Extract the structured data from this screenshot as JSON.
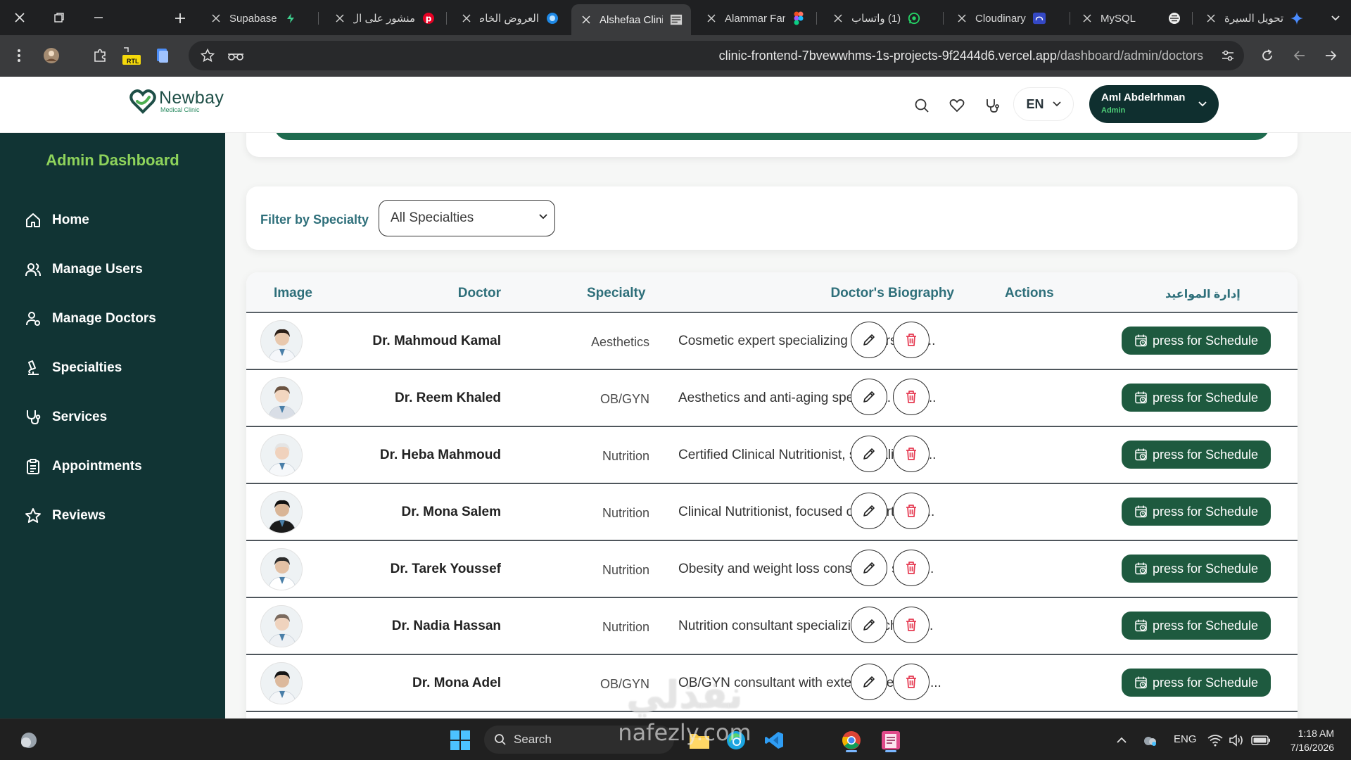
{
  "browser": {
    "tabs": [
      {
        "title": "Supabase",
        "icon": "supabase-icon"
      },
      {
        "title": "منشور على ال",
        "icon": "pinterest-icon"
      },
      {
        "title": "العروض الخاصة",
        "icon": "circle-icon"
      },
      {
        "title": "Alshefaa Clinic",
        "icon": "page-icon",
        "active": true
      },
      {
        "title": "Alammar Family",
        "icon": "figma-icon"
      },
      {
        "title": "(1) واتساب",
        "icon": "whatsapp-icon"
      },
      {
        "title": "Cloudinary",
        "icon": "cloudinary-icon"
      },
      {
        "title": "MySQL",
        "icon": "mysql-icon"
      },
      {
        "title": "تحويل السيرة",
        "icon": "gemini-icon"
      }
    ],
    "url_host": "clinic-frontend-7bvewwhms-1s-projects-9f2444d6.vercel.app",
    "url_path": "/dashboard/admin/doctors",
    "rtl_badge": "RTL"
  },
  "header": {
    "logo_name": "Newbay",
    "logo_sub": "Medical Clinic",
    "lang": "EN",
    "user_name": "Aml Abdelrhman",
    "user_role": "Admin"
  },
  "sidebar": {
    "title": "Admin Dashboard",
    "items": [
      {
        "label": "Home",
        "icon": "home-icon"
      },
      {
        "label": "Manage Users",
        "icon": "users-icon"
      },
      {
        "label": "Manage Doctors",
        "icon": "doctor-icon"
      },
      {
        "label": "Specialties",
        "icon": "specialties-icon"
      },
      {
        "label": "Services",
        "icon": "stethoscope-icon"
      },
      {
        "label": "Appointments",
        "icon": "clipboard-icon"
      },
      {
        "label": "Reviews",
        "icon": "star-icon"
      }
    ]
  },
  "filter": {
    "label": "Filter by Specialty",
    "selected": "All Specialties"
  },
  "table": {
    "headers": {
      "image": "Image",
      "doctor": "Doctor",
      "specialty": "Specialty",
      "bio": "Doctor's Biography",
      "actions": "Actions",
      "schedule": "إدارة المواعيد"
    },
    "schedule_label": "press for Schedule",
    "rows": [
      {
        "name": "Dr. Mahmoud Kamal",
        "specialty": "Aesthetics",
        "bio": "Cosmetic expert specializing in fillers, Bot..."
      },
      {
        "name": "Dr. Reem Khaled",
        "specialty": "OB/GYN",
        "bio": "Aesthetics and anti-aging specialist. Dr. R..."
      },
      {
        "name": "Dr. Heba Mahmoud",
        "specialty": "Nutrition",
        "bio": "Certified Clinical Nutritionist, specializing i..."
      },
      {
        "name": "Dr. Mona Salem",
        "specialty": "Nutrition",
        "bio": "Clinical Nutritionist, focused on sports nut..."
      },
      {
        "name": "Dr. Tarek Youssef",
        "specialty": "Nutrition",
        "bio": "Obesity and weight loss consultant, speci..."
      },
      {
        "name": "Dr. Nadia Hassan",
        "specialty": "Nutrition",
        "bio": "Nutrition consultant specializing in child h..."
      },
      {
        "name": "Dr. Mona Adel",
        "specialty": "OB/GYN",
        "bio": "OB/GYN consultant with extensive experie..."
      }
    ]
  },
  "taskbar": {
    "search": "Search",
    "lang": "ENG",
    "time": "1:18 AM",
    "date": "7/16/2026"
  },
  "watermark": {
    "arabic": "نفذلي",
    "latin": "nafezly.com"
  },
  "colors": {
    "sidebar_bg": "#113434",
    "accent_green": "#8ed35b",
    "schedule_btn": "#1e5a3f",
    "header_text": "#2e6f7a",
    "delete_red": "#e53950"
  }
}
